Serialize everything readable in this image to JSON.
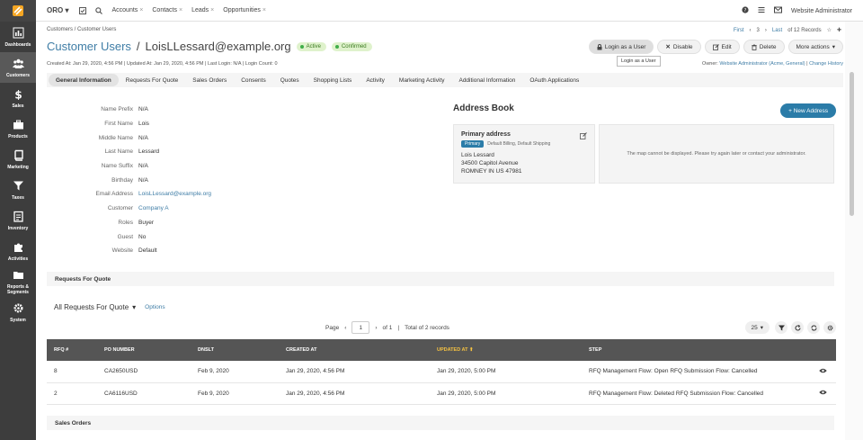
{
  "sidebar": {
    "items": [
      {
        "label": "Dashboards",
        "icon": "bar-chart-icon"
      },
      {
        "label": "Customers",
        "icon": "users-icon",
        "active": true
      },
      {
        "label": "Sales",
        "icon": "dollar-icon"
      },
      {
        "label": "Products",
        "icon": "briefcase-icon"
      },
      {
        "label": "Marketing",
        "icon": "book-icon"
      },
      {
        "label": "Taxes",
        "icon": "filter-icon"
      },
      {
        "label": "Inventory",
        "icon": "clipboard-icon"
      },
      {
        "label": "Activities",
        "icon": "puzzle-icon"
      },
      {
        "label": "Reports & Segments",
        "icon": "folder-icon"
      },
      {
        "label": "System",
        "icon": "gear-icon"
      }
    ]
  },
  "topbar": {
    "brand": "ORO",
    "pinned": [
      "Accounts",
      "Contacts",
      "Leads",
      "Opportunities"
    ],
    "user": "Website Administrator"
  },
  "header": {
    "breadcrumb": "Customers / Customer Users",
    "pager": {
      "first": "First",
      "current": "3",
      "last": "Last",
      "of": "of 12 Records"
    },
    "title_entity": "Customer Users",
    "title_sep": "/",
    "title_name": "LoisLLessard@example.org",
    "badges": [
      "Active",
      "Confirmed"
    ],
    "meta": "Created At: Jan 29, 2020, 4:56 PM  |  Updated At: Jan 29, 2020, 4:56 PM  |  Last Login: N/A  |  Login Count: 0",
    "owner_label": "Owner:",
    "owner_value": "Website Administrator (Acme, General)",
    "change_history": "Change History",
    "actions": {
      "login": "Login as a User",
      "disable": "Disable",
      "edit": "Edit",
      "delete": "Delete",
      "more": "More actions"
    },
    "tooltip": "Login as a User"
  },
  "tabs": [
    "General Information",
    "Requests For Quote",
    "Sales Orders",
    "Consents",
    "Quotes",
    "Shopping Lists",
    "Activity",
    "Marketing Activity",
    "Additional Information",
    "OAuth Applications"
  ],
  "general": [
    {
      "label": "Name Prefix",
      "value": "N/A"
    },
    {
      "label": "First Name",
      "value": "Lois"
    },
    {
      "label": "Middle Name",
      "value": "N/A"
    },
    {
      "label": "Last Name",
      "value": "Lessard"
    },
    {
      "label": "Name Suffix",
      "value": "N/A"
    },
    {
      "label": "Birthday",
      "value": "N/A"
    },
    {
      "label": "Email Address",
      "value": "LoisLLessard@example.org",
      "link": true
    },
    {
      "label": "Customer",
      "value": "Company A",
      "link": true
    },
    {
      "label": "Roles",
      "value": "Buyer"
    },
    {
      "label": "Guest",
      "value": "No"
    },
    {
      "label": "Website",
      "value": "Default"
    }
  ],
  "address_book": {
    "title": "Address Book",
    "new_button": "+ New Address",
    "card": {
      "heading": "Primary address",
      "tag": "Primary",
      "tag_note": "Default Billing, Default Shipping",
      "lines": [
        "Lois Lessard",
        "34500 Capitol Avenue",
        "ROMNEY IN US 47981"
      ]
    },
    "map_message": "The map cannot be displayed. Please try again later or contact your administrator."
  },
  "rfq": {
    "section_title": "Requests For Quote",
    "grid_title": "All Requests For Quote",
    "options": "Options",
    "pager": {
      "page_label": "Page",
      "page": "1",
      "of": "of 1",
      "total": "Total of 2 records"
    },
    "per_page": "25",
    "columns": [
      "RFQ #",
      "PO NUMBER",
      "DNSLT",
      "CREATED AT",
      "UPDATED AT",
      "STEP"
    ],
    "rows": [
      [
        "8",
        "CA2650USD",
        "Feb 9, 2020",
        "Jan 29, 2020, 4:56 PM",
        "Jan 29, 2020, 5:00 PM",
        "RFQ Management Flow: Open RFQ Submission Flow: Cancelled"
      ],
      [
        "2",
        "CA6116USD",
        "Feb 9, 2020",
        "Jan 29, 2020, 4:56 PM",
        "Jan 29, 2020, 5:00 PM",
        "RFQ Management Flow: Deleted RFQ Submission Flow: Cancelled"
      ]
    ]
  },
  "sales_orders": {
    "section_title": "Sales Orders"
  },
  "colors": {
    "sidebar": "#3d3d3d",
    "link": "#3f7da6",
    "primary_button": "#2b7ca8",
    "badge_bg": "#dff2cc",
    "grid_header": "#555555",
    "sorted_header": "#f5c242"
  }
}
